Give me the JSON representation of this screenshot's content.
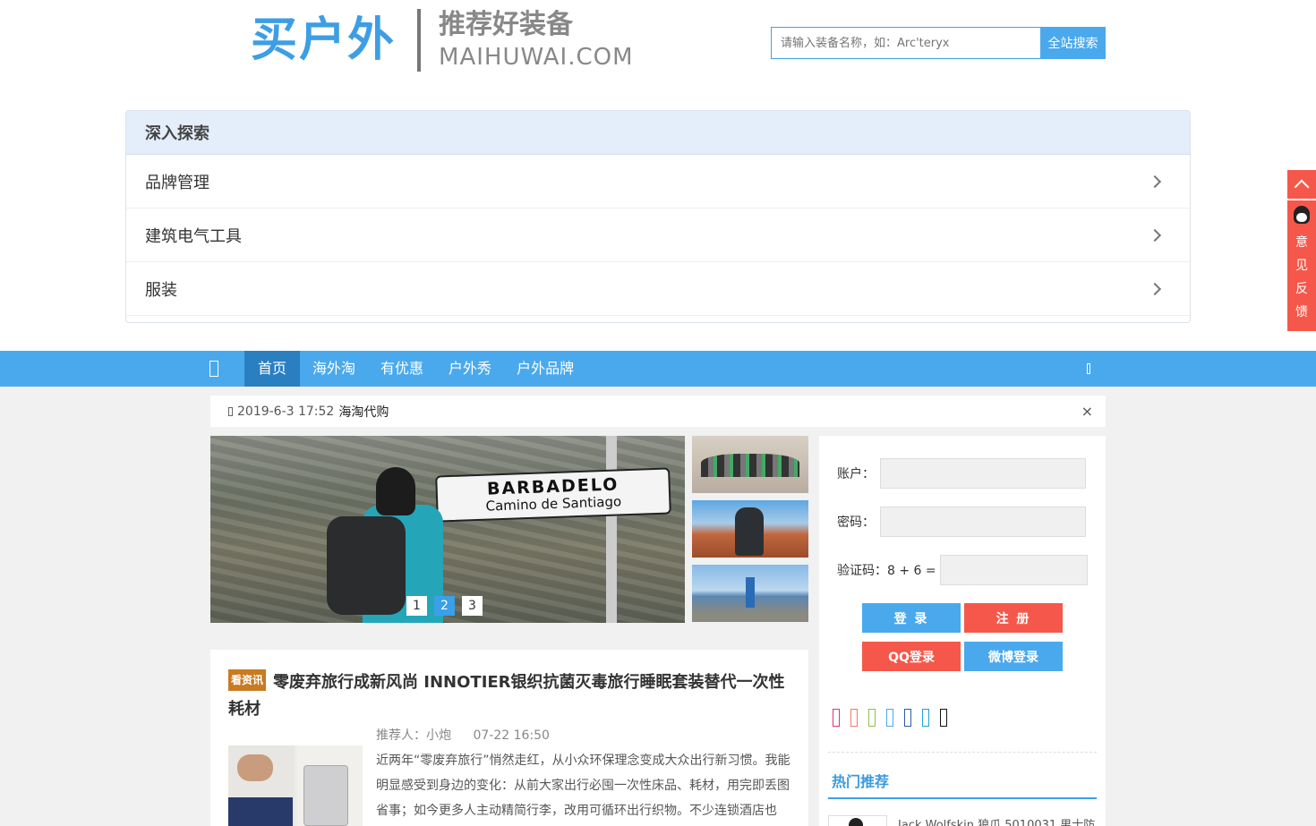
{
  "header": {
    "logo_main": "买户外",
    "logo_sub1": "推荐好装备",
    "logo_sub2": "MAIHUWAI.COM",
    "search_placeholder": "请输入装备名称，如：Arc'teryx",
    "search_button": "全站搜索"
  },
  "explore": {
    "title": "深入探索",
    "items": [
      {
        "label": "品牌管理"
      },
      {
        "label": "建筑电气工具"
      },
      {
        "label": "服装"
      }
    ]
  },
  "nav": {
    "items": [
      {
        "label": "首页",
        "active": true
      },
      {
        "label": "海外淘"
      },
      {
        "label": "有优惠"
      },
      {
        "label": "户外秀"
      },
      {
        "label": "户外品牌"
      }
    ]
  },
  "float": {
    "feedback": [
      "意",
      "见",
      "反",
      "馈"
    ]
  },
  "notice": {
    "date": "2019-6-3 17:52",
    "title": "海淘代购",
    "close": "×"
  },
  "slider": {
    "sign_line1": "BARBADELO",
    "sign_line2": "Camino de Santiago",
    "dots": [
      "1",
      "2",
      "3"
    ],
    "active_dot": 2
  },
  "login": {
    "account_label": "账户：",
    "password_label": "密码：",
    "captcha_label": "验证码：8 + 6 =",
    "login_button": "登 录",
    "register_button": "注 册",
    "qq_button": " QQ登录",
    "weibo_button": " 微博登录",
    "share_colors": [
      "#e0336b",
      "#f07a6a",
      "#8bc34a",
      "#4aa9ed",
      "#2a5caa",
      "#1da1d4",
      "#111111"
    ],
    "hot_title": "热门推荐",
    "hot_item": "Jack Wolfskin 狼爪 5010031 男士防"
  },
  "article": {
    "tag": "看资讯",
    "title": "零废弃旅行成新风尚 INNOTIER银织抗菌灭毒旅行睡眠套装替代一次性耗材",
    "author": "推荐人：小炮",
    "time": "07-22 16:50",
    "text": "近两年“零废弃旅行”悄然走红，从小众环保理念变成大众出行新习惯。我能明显感受到身边的变化：从前大家出行必囤一次性床品、耗材，用完即丢图省事；如今更多人主动精简行李，改用可循环出行织物。不少连锁酒店也"
  }
}
